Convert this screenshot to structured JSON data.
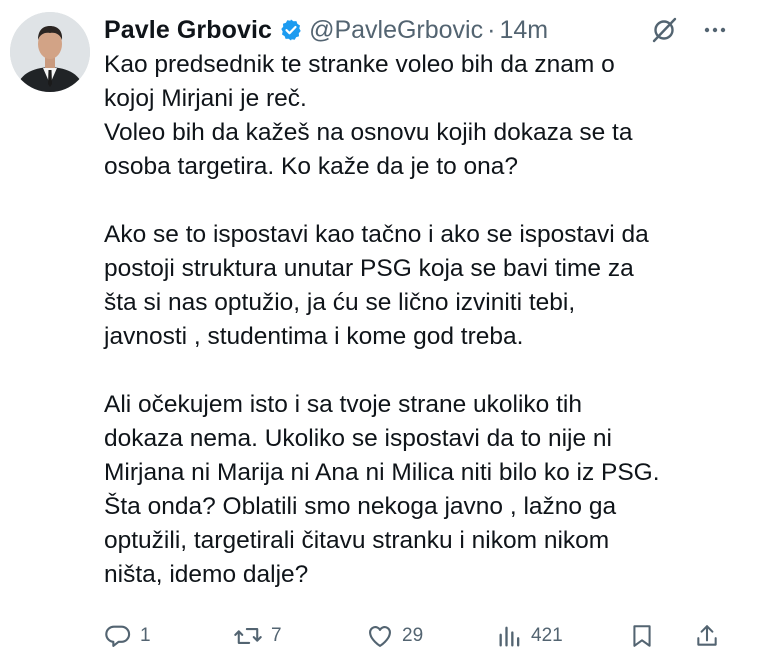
{
  "author": {
    "name": "Pavle Grbovic",
    "handle": "@PavleGrbovic",
    "separator": "·",
    "time": "14m"
  },
  "tweet": {
    "paragraphs": [
      [
        "Kao predsednik te stranke voleo bih da znam o",
        "kojoj Mirjani je reč.",
        "Voleo bih da kažeš na osnovu kojih dokaza se ta",
        "osoba targetira. Ko kaže da je to ona?"
      ],
      [
        "Ako se to ispostavi kao tačno i ako se ispostavi da",
        "postoji struktura unutar PSG koja se bavi time za",
        "šta si nas optužio, ja ću se lično izviniti tebi,",
        "javnosti , studentima i kome god treba."
      ],
      [
        "Ali očekujem isto i sa tvoje strane ukoliko tih",
        "dokaza nema. Ukoliko se ispostavi da to nije ni",
        "Mirjana ni Marija ni Ana ni Milica niti bilo ko iz PSG.",
        "Šta onda? Oblatili smo nekoga javno , lažno ga",
        "optužili, targetirali čitavu stranku i nikom nikom",
        "ništa, idemo dalje?"
      ]
    ]
  },
  "actions": {
    "replies": "1",
    "reposts": "7",
    "likes": "29",
    "views": "421"
  },
  "colors": {
    "text": "#0f1419",
    "secondary": "#536471",
    "verified": "#1d9bf0"
  },
  "icons": [
    "verified-badge-icon",
    "grok-icon",
    "more-icon",
    "reply-icon",
    "repost-icon",
    "like-icon",
    "views-icon",
    "bookmark-icon",
    "share-icon"
  ]
}
